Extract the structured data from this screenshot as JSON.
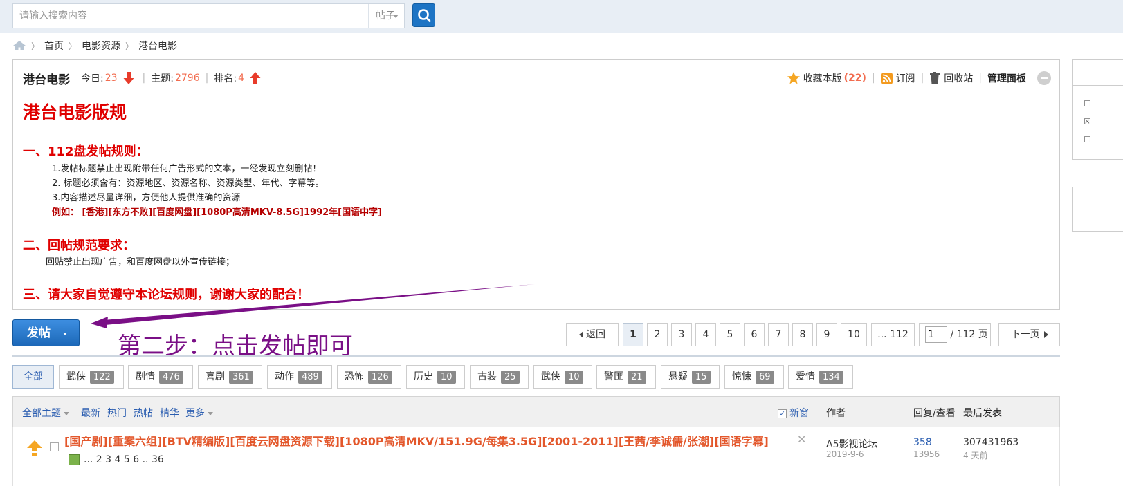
{
  "search": {
    "placeholder": "请输入搜索内容",
    "type_label": "帖子"
  },
  "breadcrumb": [
    "首页",
    "电影资源",
    "港台电影"
  ],
  "forum": {
    "name": "港台电影",
    "today_label": "今日:",
    "today_value": "23",
    "topics_label": "主题:",
    "topics_value": "2796",
    "rank_label": "排名:",
    "rank_value": "4",
    "favorite_label": "收藏本版",
    "favorite_count": "(22)",
    "subscribe_label": "订阅",
    "recycle_label": "回收站",
    "manage_label": "管理面板"
  },
  "rules": {
    "title": "港台电影版规",
    "section1_title": "一、112盘发帖规则：",
    "section1_lines": [
      "1.发帖标题禁止出现附带任何广告形式的文本，一经发现立刻删帖！",
      "2. 标题必须含有：资源地区、资源名称、资源类型、年代、字幕等。",
      "3.内容描述尽量详细，方便他人提供准确的资源"
    ],
    "section1_example": "例如：  [香港][东方不败][百度网盘][1080P高清MKV-8.5G]1992年[国语中字]",
    "section2_title": "二、回帖规范要求：",
    "section2_line": "回贴禁止出现广告，和百度网盘以外宣传链接；",
    "section3_title": "三、请大家自觉遵守本论坛规则，谢谢大家的配合！"
  },
  "annotation": {
    "step_text": "第二步：点击发帖即可",
    "arrow_color": "#7a0f86"
  },
  "post_button_label": "发帖",
  "pager": {
    "back_label": "返回",
    "pages": [
      "1",
      "2",
      "3",
      "4",
      "5",
      "6",
      "7",
      "8",
      "9",
      "10"
    ],
    "last_label": "... 112",
    "current_input": "1",
    "total_label": "/ 112 页",
    "next_label": "下一页"
  },
  "tags": [
    {
      "label": "全部",
      "count": ""
    },
    {
      "label": "武侠",
      "count": "122"
    },
    {
      "label": "剧情",
      "count": "476"
    },
    {
      "label": "喜剧",
      "count": "361"
    },
    {
      "label": "动作",
      "count": "489"
    },
    {
      "label": "恐怖",
      "count": "126"
    },
    {
      "label": "历史",
      "count": "10"
    },
    {
      "label": "古装",
      "count": "25"
    },
    {
      "label": "武侠",
      "count": "10"
    },
    {
      "label": "警匪",
      "count": "21"
    },
    {
      "label": "悬疑",
      "count": "15"
    },
    {
      "label": "惊悚",
      "count": "69"
    },
    {
      "label": "爱情",
      "count": "134"
    }
  ],
  "list_header": {
    "all_topics": "全部主题",
    "latest": "最新",
    "hot": "热门",
    "hot_posts": "热帖",
    "digest": "精华",
    "more": "更多",
    "new_window": "新窗",
    "author": "作者",
    "replies_views": "回复/查看",
    "last_post": "最后发表"
  },
  "thread": {
    "title": "[国产剧][重案六组][BTV精编版][百度云网盘资源下载][1080P高清MKV/151.9G/每集3.5G][2001-2011][王茜/李诚儒/张潮][国语字幕]",
    "pages": "... 2  3  4  5  6 .. 36",
    "author": "A5影视论坛",
    "date": "2019-9-6",
    "replies": "358",
    "views": "13956",
    "last_poster": "307431963",
    "last_time": "4 天前"
  },
  "colors": {
    "accent": "#1d74c4",
    "rule_red": "#e00000",
    "stat_orange": "#f26c4f",
    "link_blue": "#2a5db0"
  }
}
